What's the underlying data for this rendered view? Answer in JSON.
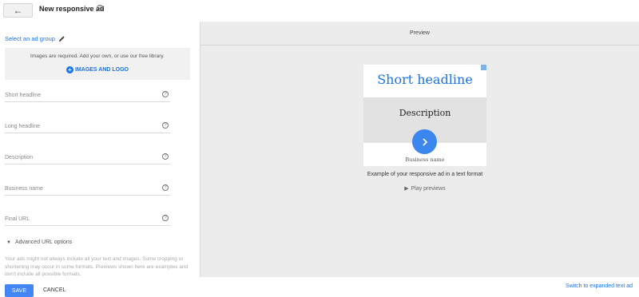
{
  "header": {
    "back_icon": "arrow-left-icon",
    "title": "New responsive ad",
    "help_icon": "help-circle-icon"
  },
  "form": {
    "select_group_label": "Select an ad group",
    "images": {
      "required_text": "Images are required. Add your own, or use our free library.",
      "button_label": "IMAGES AND LOGO"
    },
    "fields": [
      {
        "label": "Short headline"
      },
      {
        "label": "Long headline"
      },
      {
        "label": "Description"
      },
      {
        "label": "Business name"
      },
      {
        "label": "Final URL"
      }
    ],
    "advanced_url_label": "Advanced URL options",
    "disclaimer": "Your ads might not always include all your text and images. Some cropping or shortening may occur in some formats. Previews shown here are examples and don't include all possible formats."
  },
  "preview": {
    "header": "Preview",
    "ad": {
      "headline": "Short headline",
      "description": "Description",
      "business_name": "Business name"
    },
    "caption": "Example of your responsive ad in a text format",
    "play_label": "Play previews"
  },
  "footer": {
    "save_label": "SAVE",
    "cancel_label": "CANCEL",
    "switch_label": "Switch to expanded text ad"
  },
  "colors": {
    "accent": "#1a73e8",
    "save_button": "#4285f4",
    "cta_circle": "#3c86f0",
    "preview_bg": "#ececec"
  }
}
